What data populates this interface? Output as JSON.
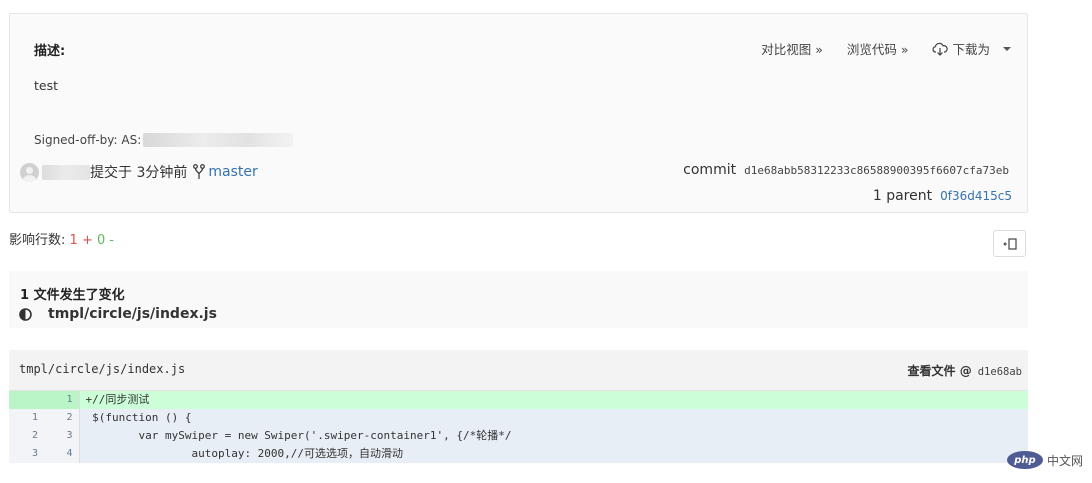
{
  "commit": {
    "description_label": "描述:",
    "description_text": "test",
    "signed_off_by": "Signed-off-by: AS:",
    "committed_text": "提交于 3分钟前",
    "branch": "master",
    "commit_label": "commit",
    "commit_hash": "d1e68abb58312233c86588900395f6607cfa73eb",
    "parent_label": "1 parent",
    "parent_hash": "0f36d415c5"
  },
  "actions": {
    "compare": "对比视图 »",
    "browse": "浏览代码 »",
    "download": "下载为"
  },
  "stats": {
    "label": "影响行数:",
    "deleted": "1",
    "plus": "+",
    "added": "0",
    "minus": "-"
  },
  "files": {
    "summary": "1 文件发生了变化",
    "items": [
      "tmpl/circle/js/index.js"
    ]
  },
  "diff": {
    "path": "tmpl/circle/js/index.js",
    "view_file": "查看文件 @",
    "short_hash": "d1e68ab",
    "lines": [
      {
        "old": "",
        "new": "1",
        "code": "+//同步测试"
      },
      {
        "old": "1",
        "new": "2",
        "code": " $(function () {"
      },
      {
        "old": "2",
        "new": "3",
        "code": "        var mySwiper = new Swiper('.swiper-container1', {/*轮播*/"
      },
      {
        "old": "3",
        "new": "4",
        "code": "                autoplay: 2000,//可选选项，自动滑动"
      }
    ]
  },
  "watermark": {
    "logo": "php",
    "text": "中文网"
  }
}
